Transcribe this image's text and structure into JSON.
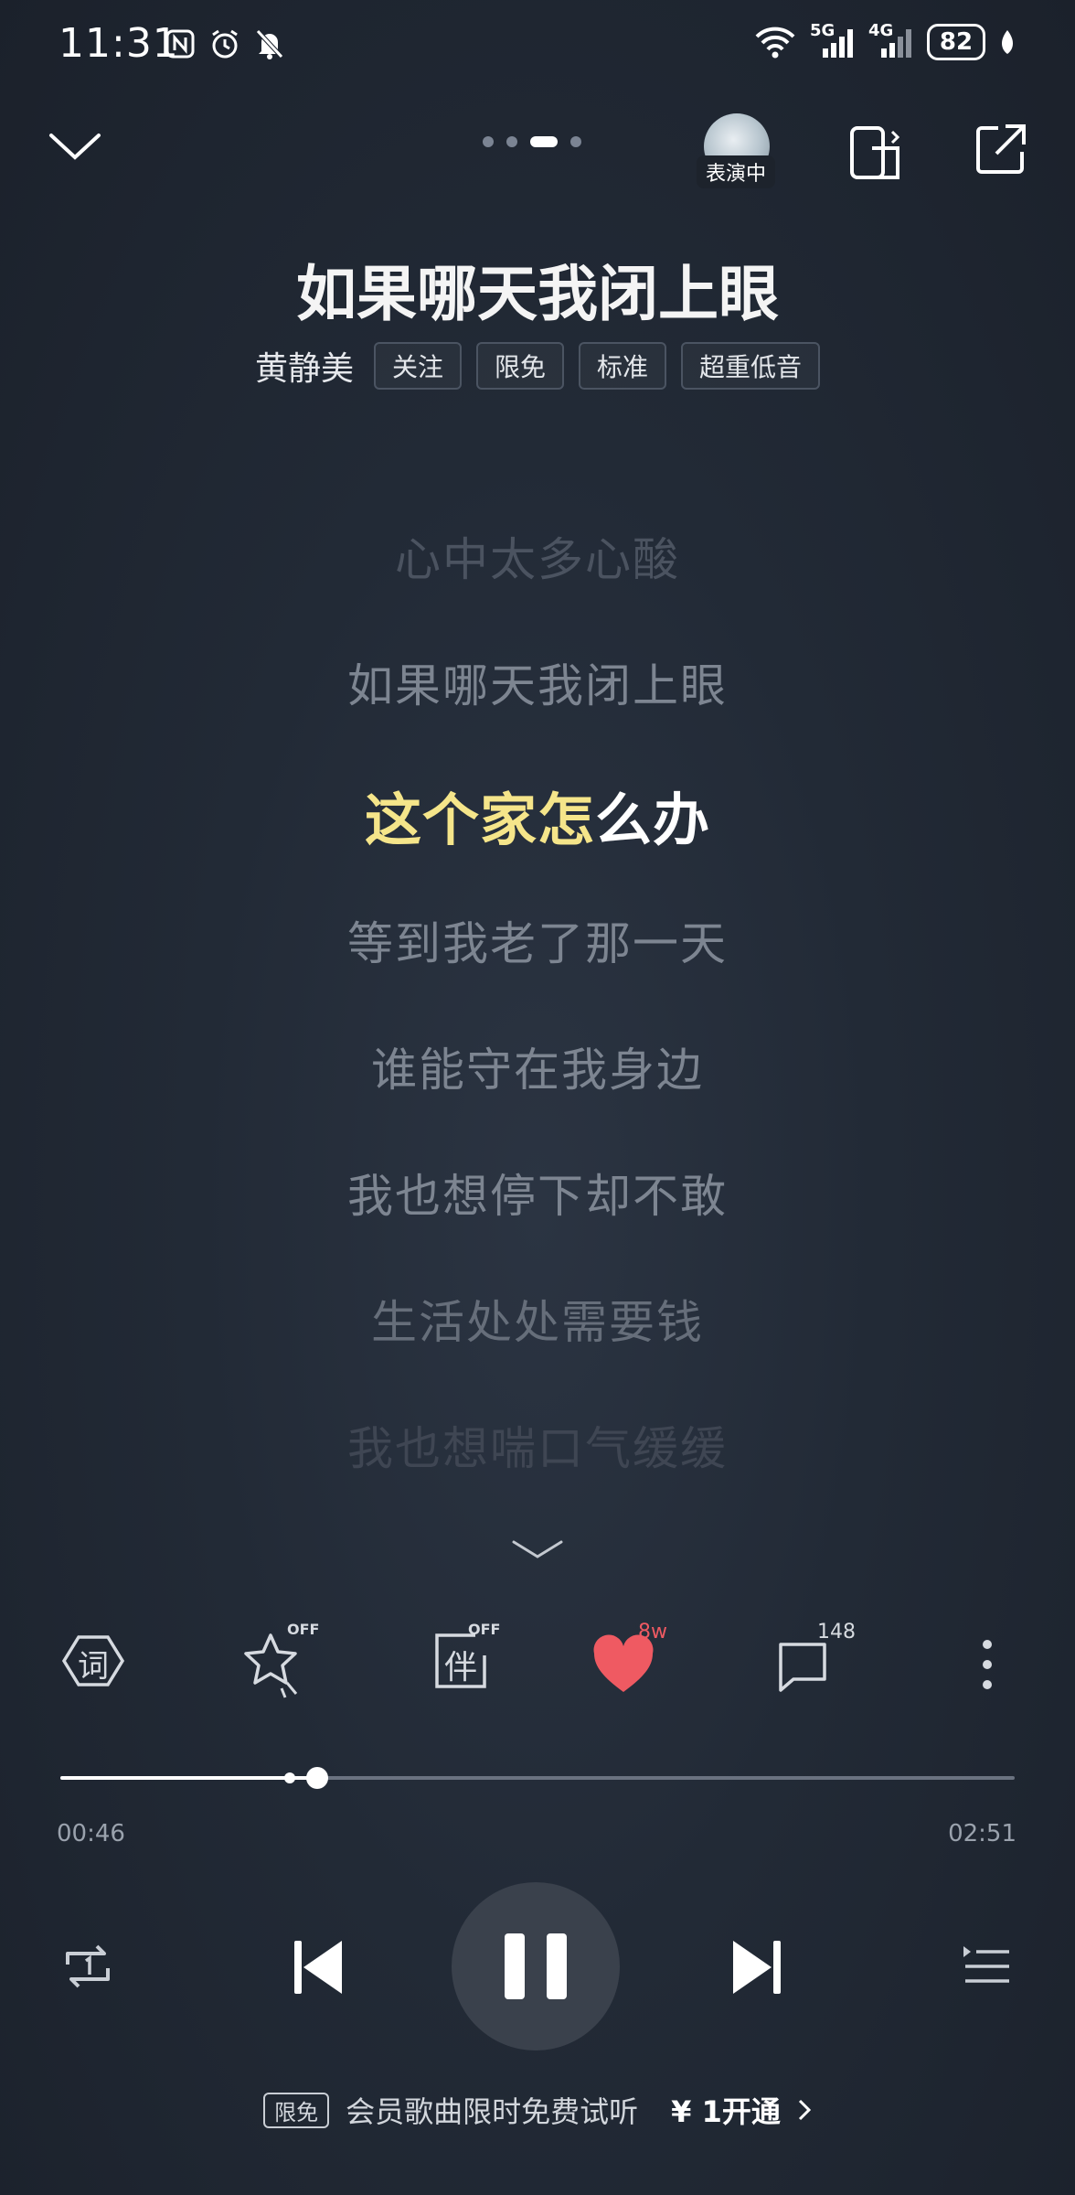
{
  "status_bar": {
    "time": "11:31",
    "battery": "82",
    "net1": "5G",
    "net2": "4G"
  },
  "header": {
    "avatar_badge": "表演中",
    "page_count": 4,
    "active_page": 3
  },
  "song": {
    "title": "如果哪天我闭上眼",
    "artist": "黄静美",
    "tags": [
      "关注",
      "限免",
      "标准",
      "超重低音"
    ]
  },
  "lyrics": {
    "before": [
      "心中太多心酸",
      "如果哪天我闭上眼"
    ],
    "current_sung": "这个家怎",
    "current_unsung": "么办",
    "after": [
      "等到我老了那一天",
      "谁能守在我身边",
      "我也想停下却不敢",
      "生活处处需要钱",
      "我也想喘口气缓缓"
    ]
  },
  "actions": {
    "lyric_label": "词",
    "effect_state": "OFF",
    "accompany_label": "伴",
    "accompany_state": "OFF",
    "likes": "8w",
    "comments": "148"
  },
  "progress": {
    "current": "00:46",
    "total": "02:51",
    "fraction": 0.269
  },
  "promo": {
    "badge": "限免",
    "text": "会员歌曲限时免费试听",
    "price": "¥ 1开通"
  },
  "colors": {
    "sung": "#f5e58a",
    "like": "#ef5a62"
  }
}
